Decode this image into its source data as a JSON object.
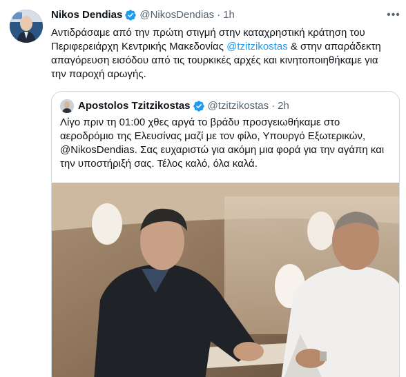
{
  "tweet": {
    "author_name": "Nikos Dendias",
    "author_handle": "@NikosDendias",
    "separator": "·",
    "time": "1h",
    "more_icon": "more-horizontal-icon",
    "text_before": "Αντιδράσαμε από την πρώτη στιγμή στην καταχρηστική κράτηση του Περιφερειάρχη Κεντρικής Μακεδονίας ",
    "mention": "@tzitzikostas",
    "text_after": " & στην απαράδεκτη απαγόρευση εισόδου από τις τουρκικές αρχές και κινητοποιηθήκαμε για την παροχή αρωγής."
  },
  "quoted": {
    "author_name": "Apostolos Tzitzikostas",
    "author_handle": "@tzitzikostas",
    "separator": "·",
    "time": "2h",
    "text": "Λίγο πριν τη 01:00 χθες αργά το βράδυ προσγειωθήκαμε στο αεροδρόμιο της Ελευσίνας μαζί με τον φίλο, Υπουργό Εξωτερικών, @NikosDendias. Σας ευχαριστώ για ακόμη μια φορά για την αγάπη και την υποστήριξή σας. Τέλος καλό, όλα καλά."
  },
  "colors": {
    "accent": "#1d9bf0",
    "secondary_text": "#536471",
    "primary_text": "#0f1419",
    "border": "#cfd9de"
  }
}
